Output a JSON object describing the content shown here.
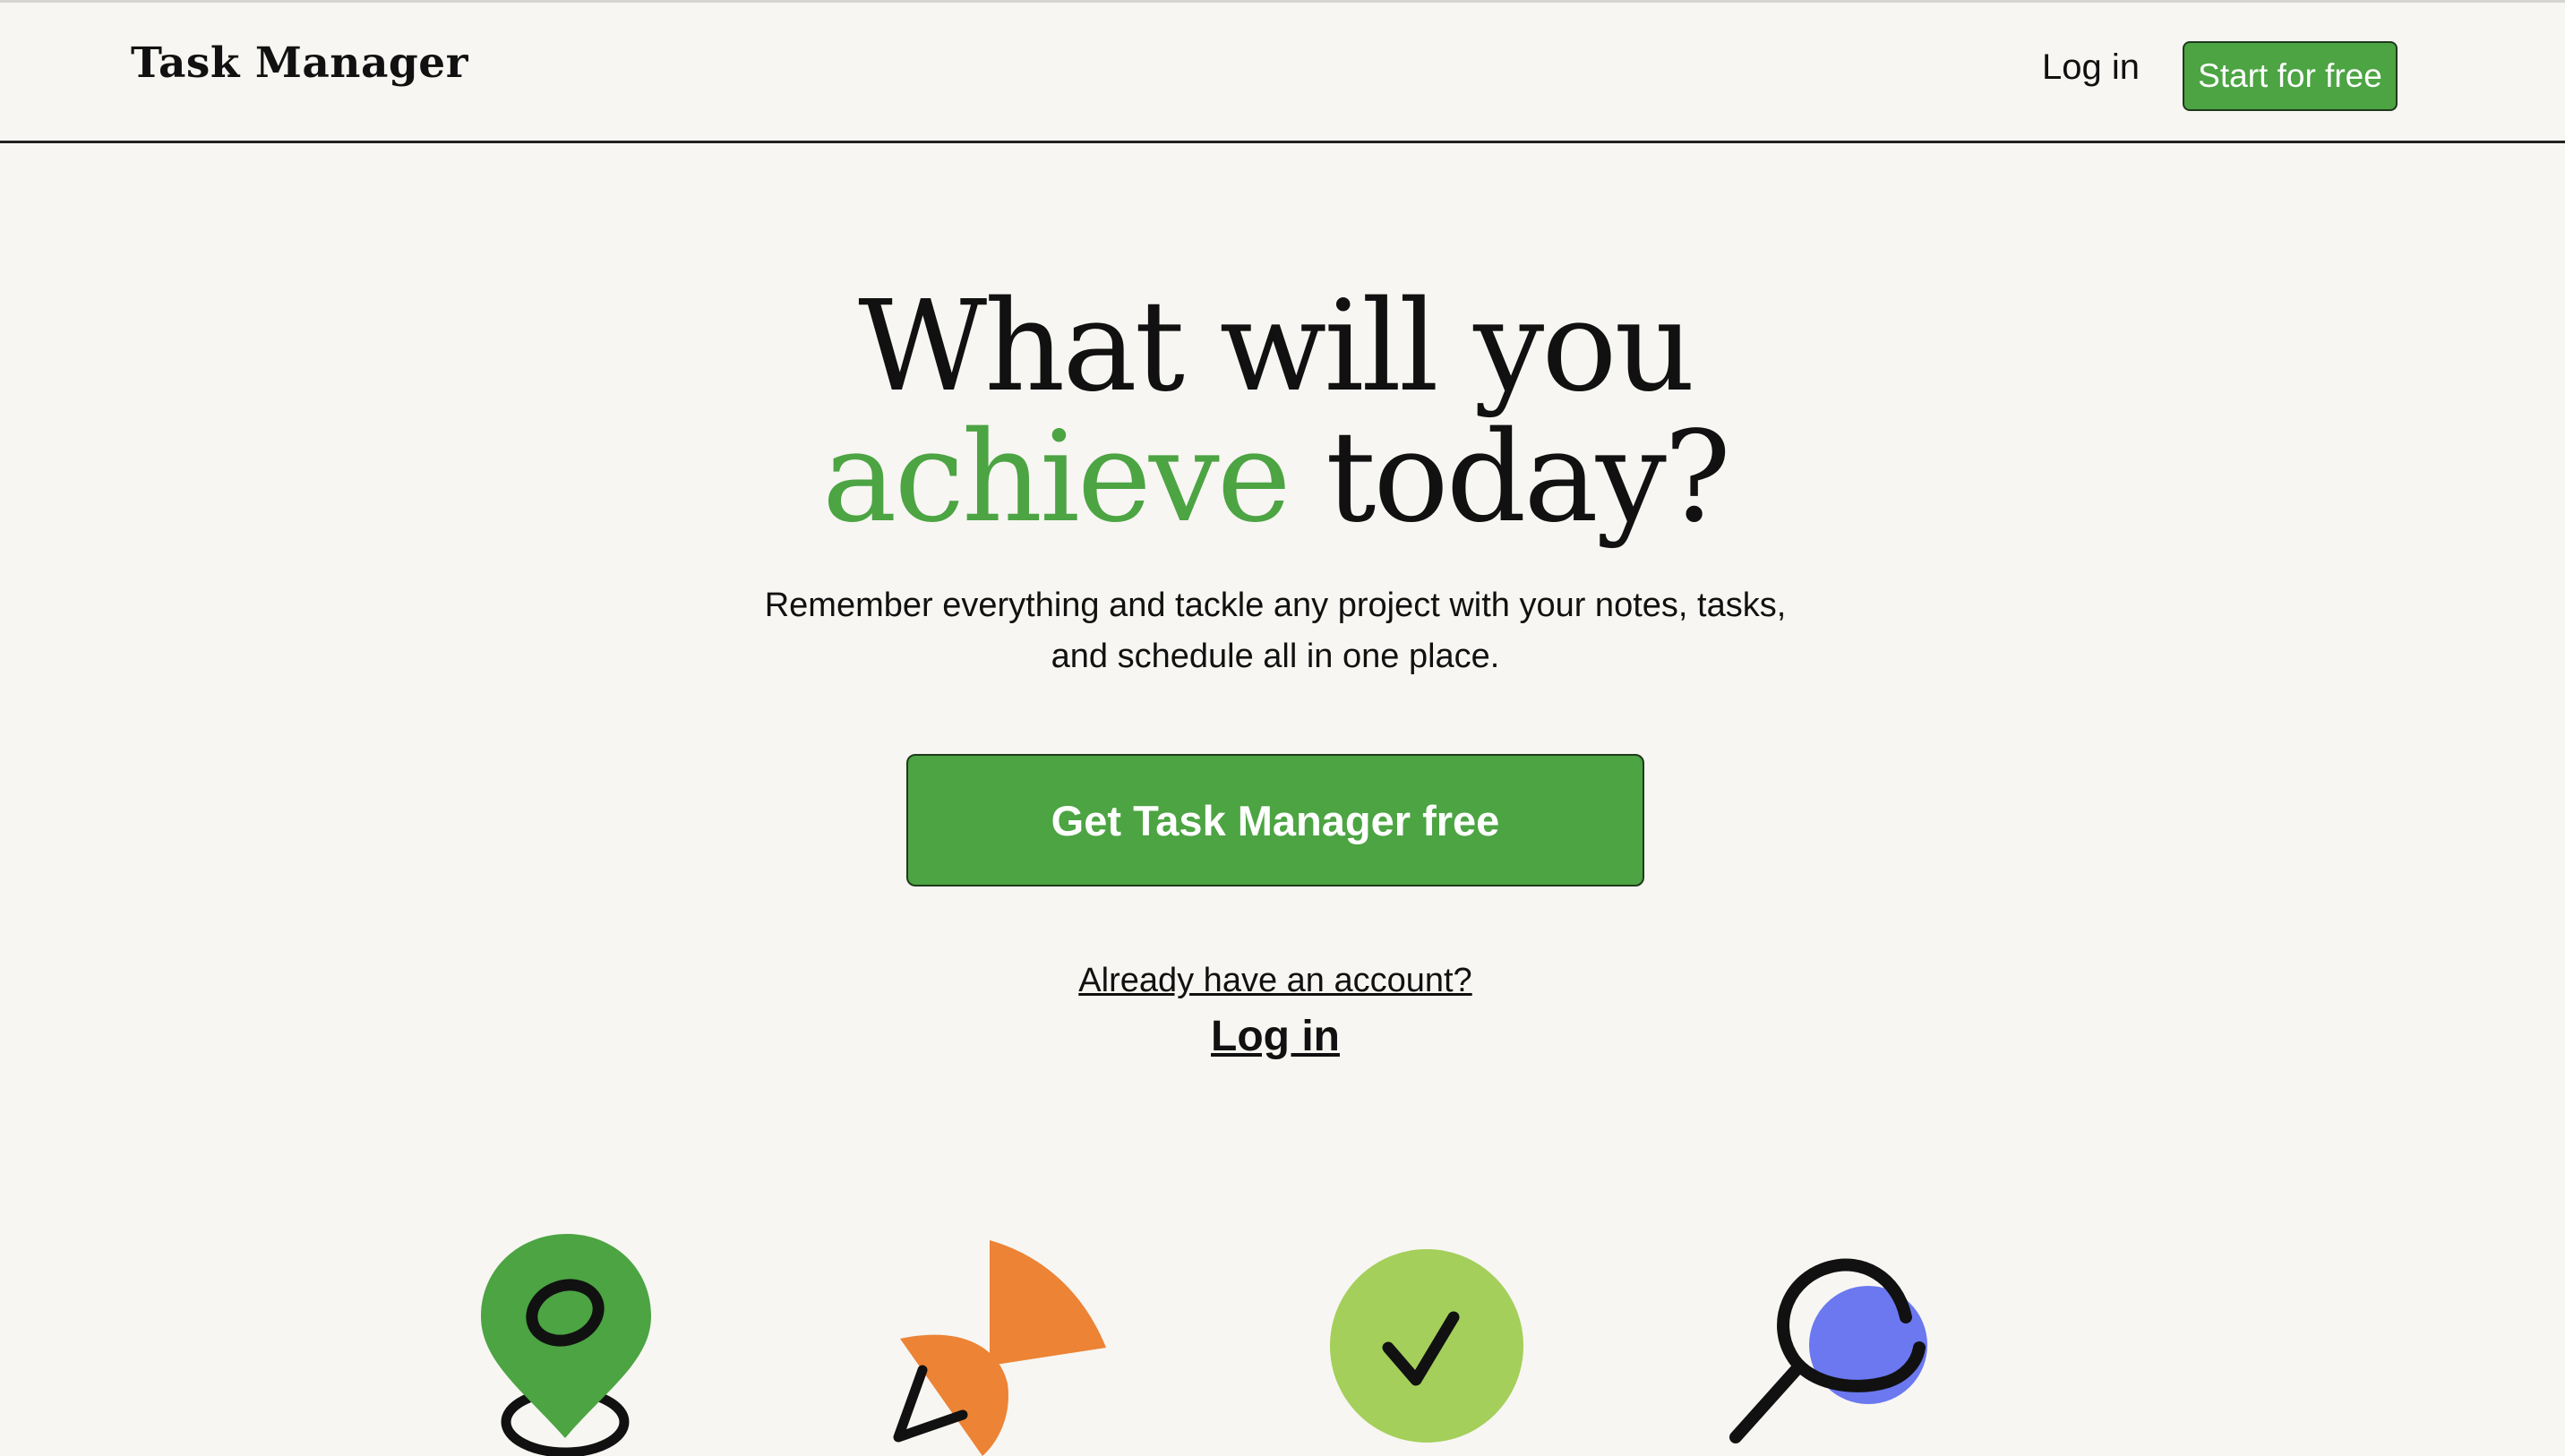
{
  "header": {
    "brand": "Task Manager",
    "login_label": "Log in",
    "start_label": "Start for free"
  },
  "hero": {
    "title_line1": "What will you",
    "title_accent": "achieve",
    "title_rest": " today?",
    "subtitle_line1": "Remember everything and tackle any project with your notes, tasks,",
    "subtitle_line2": "and schedule all in one place.",
    "cta_label": "Get Task Manager free",
    "already_label": "Already have an account?",
    "login_link_label": "Log in"
  },
  "icons": [
    {
      "name": "location-pin-icon",
      "color": "#4ca443"
    },
    {
      "name": "paper-plane-icon",
      "color": "#ec8335"
    },
    {
      "name": "checkmark-circle-icon",
      "color": "#a4cf5a"
    },
    {
      "name": "magnifier-icon",
      "color": "#6b78f0"
    }
  ],
  "colors": {
    "accent": "#4ca443",
    "background": "#f7f6f2"
  }
}
